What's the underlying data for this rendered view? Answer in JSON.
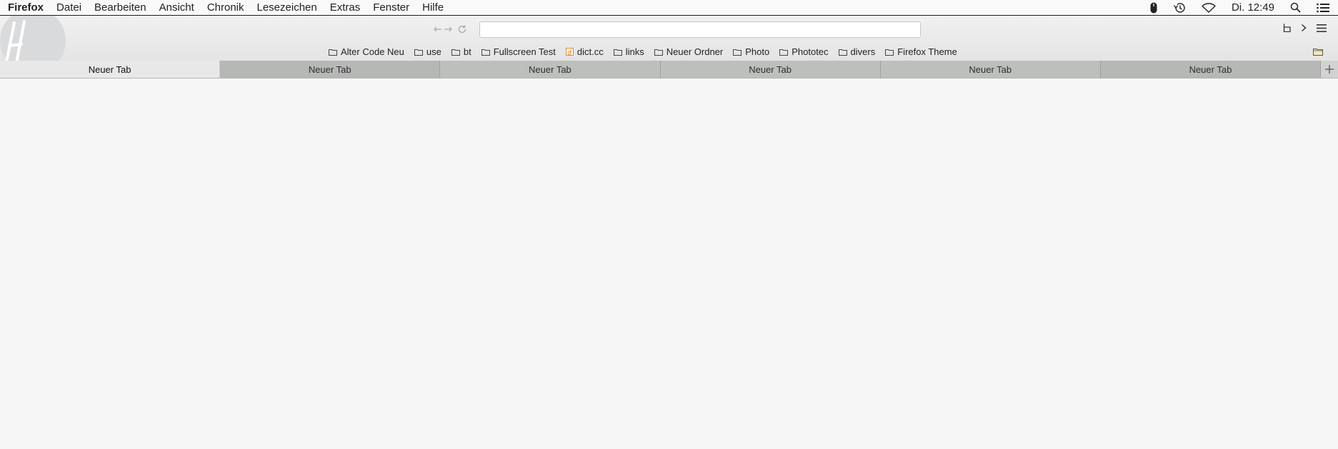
{
  "menubar": {
    "app_name": "Firefox",
    "items": [
      {
        "label": "Datei"
      },
      {
        "label": "Bearbeiten"
      },
      {
        "label": "Ansicht"
      },
      {
        "label": "Chronik"
      },
      {
        "label": "Lesezeichen"
      },
      {
        "label": "Extras"
      },
      {
        "label": "Fenster"
      },
      {
        "label": "Hilfe"
      }
    ],
    "status_icons": [
      "mouse-icon",
      "time-machine-icon",
      "wifi-icon"
    ],
    "clock": "Di. 12:49",
    "right_icons": [
      "spotlight-search-icon",
      "notification-center-icon"
    ]
  },
  "toolbar": {
    "logo_icon": "theme-logo-icon",
    "nav_icons": [
      "back-forward-icon",
      "reload-icon"
    ],
    "url_value": "",
    "right_icons": [
      "sidebar-icon",
      "overflow-chevron-icon",
      "hamburger-menu-icon"
    ]
  },
  "bookmarks": [
    {
      "label": "Alter Code Neu",
      "icon": "folder-icon"
    },
    {
      "label": "use",
      "icon": "folder-icon"
    },
    {
      "label": "bt",
      "icon": "folder-icon"
    },
    {
      "label": "Fullscreen Test",
      "icon": "folder-icon"
    },
    {
      "label": "dict.cc",
      "icon": "dictcc-favicon"
    },
    {
      "label": "links",
      "icon": "folder-icon"
    },
    {
      "label": "Neuer Ordner",
      "icon": "folder-icon"
    },
    {
      "label": "Photo",
      "icon": "folder-icon"
    },
    {
      "label": "Phototec",
      "icon": "folder-icon"
    },
    {
      "label": "divers",
      "icon": "folder-icon"
    },
    {
      "label": "Firefox Theme",
      "icon": "folder-icon"
    }
  ],
  "other_bookmarks_icon": "other-bookmarks-folder-icon",
  "tabs": [
    {
      "label": "Neuer Tab",
      "active": true
    },
    {
      "label": "Neuer Tab",
      "active": false
    },
    {
      "label": "Neuer Tab",
      "active": false
    },
    {
      "label": "Neuer Tab",
      "active": false
    },
    {
      "label": "Neuer Tab",
      "active": false
    },
    {
      "label": "Neuer Tab",
      "active": false
    }
  ],
  "new_tab_icon": "plus-icon",
  "colors": {
    "content_bg": "#f6f6f6",
    "tab_active": "#e8e8e8",
    "tab_inactive": "#bcc0bb",
    "dictcc_favicon": "#e08a2a"
  }
}
